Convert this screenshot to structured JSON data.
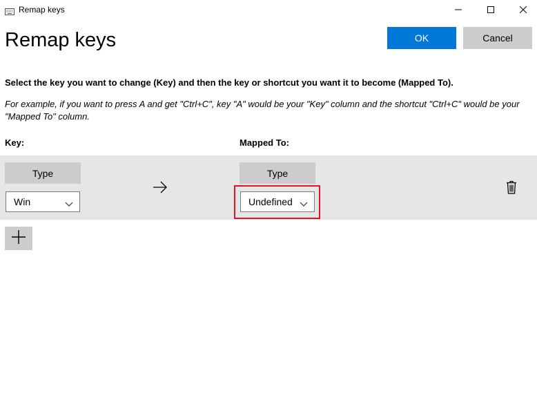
{
  "window": {
    "title": "Remap keys",
    "controls": [
      "minimize-icon",
      "maximize-icon",
      "close-icon"
    ]
  },
  "header": {
    "title": "Remap keys",
    "ok_label": "OK",
    "cancel_label": "Cancel"
  },
  "instructions": {
    "main": "Select the key you want to change (Key) and then the key or shortcut you want it to become (Mapped To).",
    "example": "For example, if you want to press A and get \"Ctrl+C\", key \"A\" would be your \"Key\" column and the shortcut \"Ctrl+C\" would be your \"Mapped To\" column."
  },
  "columns": {
    "key": "Key:",
    "mapped_to": "Mapped To:"
  },
  "rows": [
    {
      "key": {
        "type_label": "Type",
        "value": "Win"
      },
      "mapped_to": {
        "type_label": "Type",
        "value": "Undefined"
      },
      "arrow_icon": "arrow-right-icon",
      "delete_icon": "trash-icon"
    }
  ],
  "add_icon": "plus-icon",
  "colors": {
    "accent": "#0078d7",
    "button_gray": "#cccccc",
    "row_background": "#e6e6e6",
    "highlight": "#e81123"
  }
}
